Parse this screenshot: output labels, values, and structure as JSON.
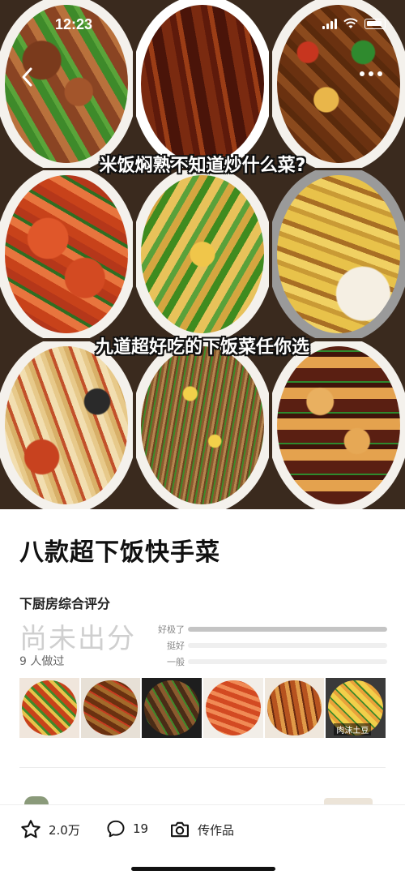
{
  "status_bar": {
    "time": "12:23"
  },
  "hero": {
    "caption_top": "米饭焖熟不知道炒什么菜?",
    "caption_bottom": "九道超好吃的下饭菜任你选",
    "back_icon": "chevron-left-icon",
    "more_icon": "more-dots-icon"
  },
  "recipe": {
    "title": "八款超下饭快手菜"
  },
  "rating": {
    "section_label": "下厨房综合评分",
    "score_text": "尚未出分",
    "count_text": "9 人做过",
    "bars": [
      {
        "label": "好极了",
        "fraction": 1.0
      },
      {
        "label": "挺好",
        "fraction": 0.0
      },
      {
        "label": "一般",
        "fraction": 0.0
      }
    ]
  },
  "works": {
    "thumbnails": [
      {
        "tag": ""
      },
      {
        "tag": ""
      },
      {
        "tag": ""
      },
      {
        "tag": ""
      },
      {
        "tag": ""
      },
      {
        "tag": "肉沫土豆"
      }
    ]
  },
  "bottom_bar": {
    "favorite": {
      "icon": "star-icon",
      "label": "2.0万"
    },
    "comment": {
      "icon": "comment-icon",
      "label": "19"
    },
    "upload": {
      "icon": "camera-icon",
      "label": "传作品"
    }
  },
  "colors": {
    "accent": "#111111",
    "bar_fill": "#c4c4c4",
    "bar_track": "#efefef",
    "muted_text": "#cfcfcf"
  }
}
